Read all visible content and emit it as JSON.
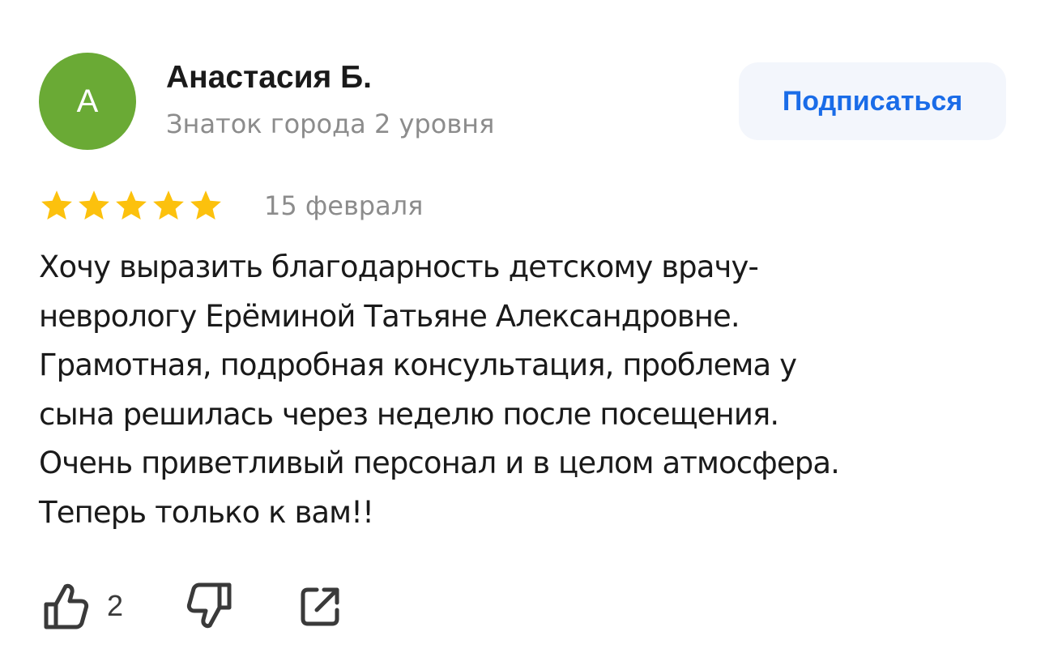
{
  "author": {
    "initial": "А",
    "name": "Анастасия Б.",
    "level": "Знаток города 2 уровня",
    "avatar_color": "#6aaa35"
  },
  "subscribe": {
    "label": "Подписаться",
    "text_color": "#1a6ce8",
    "bg_color": "#f3f6fc"
  },
  "review": {
    "rating": 5,
    "rating_max": 5,
    "star_color": "#fcc10d",
    "date": "15 февраля",
    "text_lines": [
      "Хочу выразить благодарность детскому врачу-",
      "неврологу Ерёминой Татьяне Александровне.",
      "Грамотная, подробная консультация, проблема у",
      "сына решилась через неделю после посещения.",
      "Очень приветливый персонал и в целом атмосфера.",
      "Теперь только к вам!!"
    ]
  },
  "actions": {
    "like_icon": "thumbs-up-icon",
    "like_count": "2",
    "dislike_icon": "thumbs-down-icon",
    "share_icon": "share-icon",
    "icon_color": "#3a3a3a"
  }
}
